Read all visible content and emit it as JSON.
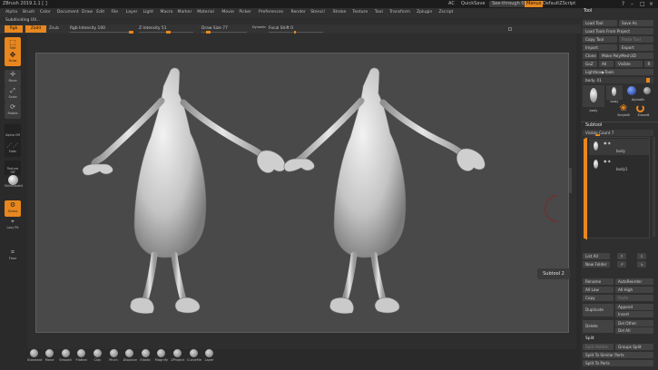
{
  "title_bar": {
    "app_title": "ZBrush 2019.1.1 [ ]",
    "ac_label": "AC",
    "quicksave": "QuickSave",
    "see_through": "See-through 0",
    "menus_btn": "Menus",
    "script_name": "DefaultZScript"
  },
  "menu": [
    "Alpha",
    "Brush",
    "Color",
    "Document",
    "Draw",
    "Edit",
    "File",
    "Layer",
    "Light",
    "Macro",
    "Marker",
    "Material",
    "Movie",
    "Picker",
    "Preferences",
    "Render",
    "Stencil",
    "Stroke",
    "Texture",
    "Tool",
    "Transform",
    "Zplugin",
    "Zscript"
  ],
  "sub_row": {
    "label": "Subdividing UV..."
  },
  "toolbar": {
    "rgb": "Rgb",
    "zadd": "Zadd",
    "zsub": "Zsub",
    "rgb_intensity": "Rgb Intensity 100",
    "z_intensity": "Z Intensity 51",
    "draw_size": "Draw Size 77",
    "dynamic": "Dynamic",
    "focal_shift": "Focal Shift 0"
  },
  "left_shelf": {
    "edit": "Edit",
    "draw": "Draw",
    "move": "Move",
    "scale": "Scale",
    "rotate": "Rotate",
    "alpha": "Alpha Off",
    "dots": "Dots",
    "texture": "Texture Off",
    "material": "SkinShade4",
    "gizmo": "Gizmo",
    "lazy": "Lazy Pit",
    "floor": "Floor"
  },
  "canvas": {
    "subtool_badge": "Subtool 2"
  },
  "bottom_brushes": [
    "Standard",
    "Move",
    "Smooth",
    "Flatten",
    "Clay",
    "Pinch",
    "Displace",
    "Elastic",
    "Magnify",
    "ZProject",
    "CurveMe",
    "Layer"
  ],
  "right_panel": {
    "title": "Tool",
    "load_tool": "Load Tool",
    "save_as": "Save As",
    "load_from_project": "Load Tools From Project",
    "copy_tool": "Copy Tool",
    "paste_tool": "Paste Tool",
    "import": "Import",
    "export": "Export",
    "clone": "Clone",
    "make_polymesh": "Make PolyMesh3D",
    "goz": "GoZ",
    "all": "All",
    "visible": "Visible",
    "r": "R",
    "lightbox_tools": "Lightbox▶Tools",
    "body_slider": "body. 41",
    "thumb_body": "body",
    "thumb_alphabrush": "AlphaBr",
    "thumb_body2": "body",
    "thumb_simplebrush": "SimpleB",
    "thumb_eraser": "EraserB",
    "subtool_header": "Subtool",
    "visible_count": "Visible Count 7",
    "subtool_items": [
      "body",
      "body1"
    ],
    "list_all": "List All",
    "new_folder": "New Folder",
    "rename": "Rename",
    "autoreorder": "AutoReorder",
    "all_low": "All Low",
    "all_high": "All High",
    "copy": "Copy",
    "paste": "Paste",
    "duplicate": "Duplicate",
    "append": "Append",
    "insert": "Insert",
    "delete": "Delete",
    "del_other": "Del Other",
    "del_all": "Del All",
    "split_header": "Split",
    "split_hidden": "Split Hidden",
    "groups_split": "Groups Split",
    "split_similar": "Split To Similar Parts",
    "split_parts": "Split To Parts"
  },
  "colors": {
    "accent": "#e8871e",
    "canvas_bg": "#494949",
    "panel_bg": "#2f2f2f"
  }
}
